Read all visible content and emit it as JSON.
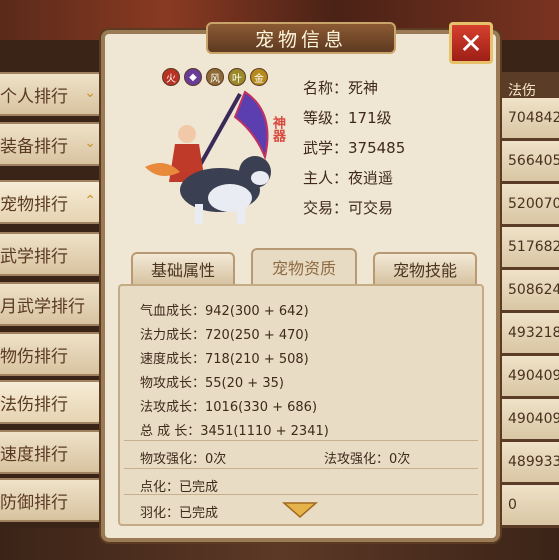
{
  "panel": {
    "title": "宠物信息"
  },
  "pet": {
    "name_label": "名称：死神",
    "level_label": "等级：171级",
    "martial_label": "武学：375485",
    "owner_label": "主人：夜逍遥",
    "trade_label": "交易：可交易",
    "element_icons": [
      "fire-element-icon",
      "shadow-element-icon",
      "wind-element-icon",
      "leaf-element-icon",
      "gold-element-icon"
    ],
    "seal_text": "神\n器"
  },
  "tabs": [
    "基础属性",
    "宠物资质",
    "宠物技能"
  ],
  "aptitude": [
    "气血成长：942(300 + 642)",
    "法力成长：720(250 + 470)",
    "速度成长：718(210 + 508)",
    "物攻成长：55(20 + 35)",
    "法攻成长：1016(330 + 686)",
    "总  成  长：3451(1110 + 2341)"
  ],
  "enhance": {
    "phys_label": "物攻强化：0次",
    "magic_label": "法攻强化：0次"
  },
  "other": {
    "dianhua_label": "点化：已完成",
    "yuhua_label": "羽化：已完成"
  },
  "left_nav": [
    "个人排行",
    "装备排行",
    "宠物排行",
    "武学排行",
    "月武学排行",
    "物伤排行",
    "法伤排行",
    "速度排行",
    "防御排行"
  ],
  "right_col": {
    "header": "法伤",
    "values": [
      "704842",
      "566405",
      "520070",
      "517682",
      "508624",
      "493218",
      "490409",
      "490409",
      "489933",
      "0"
    ]
  },
  "colors": {
    "accent": "#c9a46a",
    "close_red": "#c6352a",
    "text_brown": "#3e2a1b"
  }
}
